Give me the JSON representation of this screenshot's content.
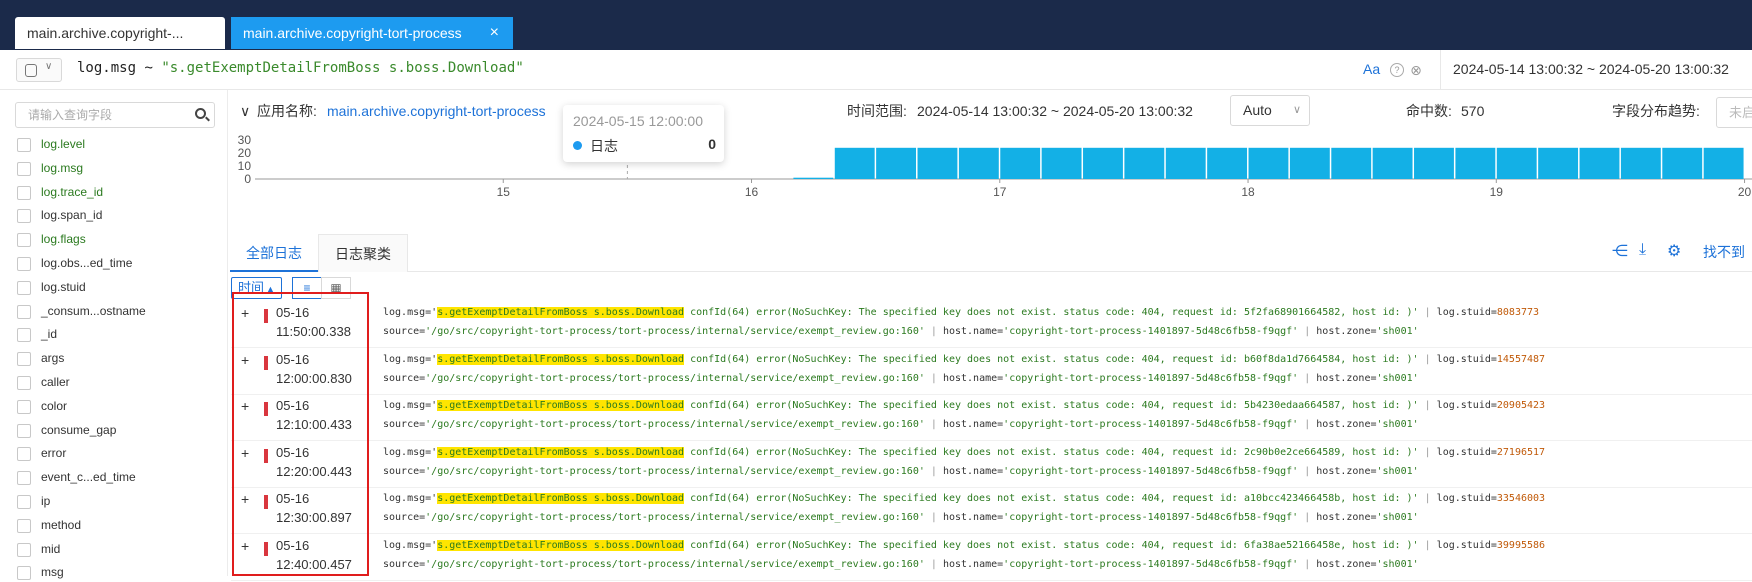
{
  "tabs": [
    {
      "label": "main.archive.copyright-...",
      "active": false
    },
    {
      "label": "main.archive.copyright-tort-process",
      "active": true
    }
  ],
  "close_glyph": "×",
  "query": {
    "field": "log.msg",
    "op": "~",
    "value": "\"s.getExemptDetailFromBoss s.boss.Download\""
  },
  "search_opts": {
    "case": "Aa",
    "help": "?",
    "clear": "⊗"
  },
  "date_range": "2024-05-14 13:00:32 ~ 2024-05-20 13:00:32",
  "field_search_placeholder": "请输入查询字段",
  "fields": [
    {
      "name": "log.level",
      "selected": true
    },
    {
      "name": "log.msg",
      "selected": true
    },
    {
      "name": "log.trace_id",
      "selected": true
    },
    {
      "name": "log.span_id",
      "selected": false
    },
    {
      "name": "log.flags",
      "selected": true
    },
    {
      "name": "log.obs...ed_time",
      "selected": false
    },
    {
      "name": "log.stuid",
      "selected": false
    },
    {
      "name": "_consum...ostname",
      "selected": false
    },
    {
      "name": "_id",
      "selected": false
    },
    {
      "name": "args",
      "selected": false
    },
    {
      "name": "caller",
      "selected": false
    },
    {
      "name": "color",
      "selected": false
    },
    {
      "name": "consume_gap",
      "selected": false
    },
    {
      "name": "error",
      "selected": false
    },
    {
      "name": "event_c...ed_time",
      "selected": false
    },
    {
      "name": "ip",
      "selected": false
    },
    {
      "name": "method",
      "selected": false
    },
    {
      "name": "mid",
      "selected": false
    },
    {
      "name": "msg",
      "selected": false
    }
  ],
  "histogram": {
    "app_label": "应用名称:",
    "app_name": "main.archive.copyright-tort-process",
    "time_range_label": "时间范围:",
    "time_range": "2024-05-14 13:00:32 ~ 2024-05-20 13:00:32",
    "interval": "Auto",
    "hits_label": "命中数:",
    "hits": "570",
    "trend_label": "字段分布趋势:",
    "trend_value": "未启"
  },
  "chart_data": {
    "type": "bar",
    "yticks": [
      "30",
      "20",
      "10",
      "0"
    ],
    "ylim": [
      0,
      30
    ],
    "xticks": [
      "15",
      "16",
      "17",
      "18",
      "19",
      "20"
    ],
    "xlim": [
      14.0,
      20.03
    ],
    "bin_days": 0.1667,
    "series": [
      {
        "name": "日志",
        "color": "#13b0e6"
      }
    ],
    "bins": [
      {
        "x": 16.25,
        "y": 1
      },
      {
        "x": 16.4167,
        "y": 24
      },
      {
        "x": 16.5833,
        "y": 24
      },
      {
        "x": 16.75,
        "y": 24
      },
      {
        "x": 16.9167,
        "y": 24
      },
      {
        "x": 17.0833,
        "y": 24
      },
      {
        "x": 17.25,
        "y": 24
      },
      {
        "x": 17.4167,
        "y": 24
      },
      {
        "x": 17.5833,
        "y": 24
      },
      {
        "x": 17.75,
        "y": 24
      },
      {
        "x": 17.9167,
        "y": 24
      },
      {
        "x": 18.0833,
        "y": 24
      },
      {
        "x": 18.25,
        "y": 24
      },
      {
        "x": 18.4167,
        "y": 24
      },
      {
        "x": 18.5833,
        "y": 24
      },
      {
        "x": 18.75,
        "y": 24
      },
      {
        "x": 18.9167,
        "y": 24
      },
      {
        "x": 19.0833,
        "y": 24
      },
      {
        "x": 19.25,
        "y": 24
      },
      {
        "x": 19.4167,
        "y": 24
      },
      {
        "x": 19.5833,
        "y": 24
      },
      {
        "x": 19.75,
        "y": 24
      },
      {
        "x": 19.9167,
        "y": 24
      }
    ],
    "hover_x": 15.5
  },
  "tooltip": {
    "title": "2024-05-15 12:00:00",
    "series": "日志",
    "value": "0"
  },
  "log_tabs": [
    "全部日志",
    "日志聚类"
  ],
  "not_found": "找不到",
  "sort_label": "时间",
  "view_toggle": {
    "list": "≡",
    "table": "▦"
  },
  "logs": [
    {
      "date": "05-16",
      "time": "11:50:00.338",
      "rid": "5f2fa68901664582",
      "stuid": "8083773"
    },
    {
      "date": "05-16",
      "time": "12:00:00.830",
      "rid": "b60f8da1d7664584",
      "stuid": "14557487"
    },
    {
      "date": "05-16",
      "time": "12:10:00.433",
      "rid": "5b4230edaa664587",
      "stuid": "20905423"
    },
    {
      "date": "05-16",
      "time": "12:20:00.443",
      "rid": "2c90b0e2ce664589",
      "stuid": "27196517"
    },
    {
      "date": "05-16",
      "time": "12:30:00.897",
      "rid": "a10bcc423466458b",
      "stuid": "33546003"
    },
    {
      "date": "05-16",
      "time": "12:40:00.457",
      "rid": "6fa38ae52166458e",
      "stuid": "39995586"
    }
  ],
  "log_tpl": {
    "msg_key": "log.msg=",
    "msg_hl": "s.getExemptDetailFromBoss s.boss.Download",
    "msg_mid": " confId(64) error(NoSuchKey: The specified key does not exist. status code: 404, request id: ",
    "msg_tail": ", host id: )'",
    "stuid_key": "log.stuid=",
    "source_key": "source=",
    "source_val": "'/go/src/copyright-tort-process/tort-process/internal/service/exempt_review.go:160'",
    "host_key": "host.name=",
    "host_val": "'copyright-tort-process-1401897-5d48c6fb58-f9qgf'",
    "zone_key": "host.zone=",
    "zone_val": "'sh001'",
    "pipe": "|",
    "plus": "+"
  }
}
